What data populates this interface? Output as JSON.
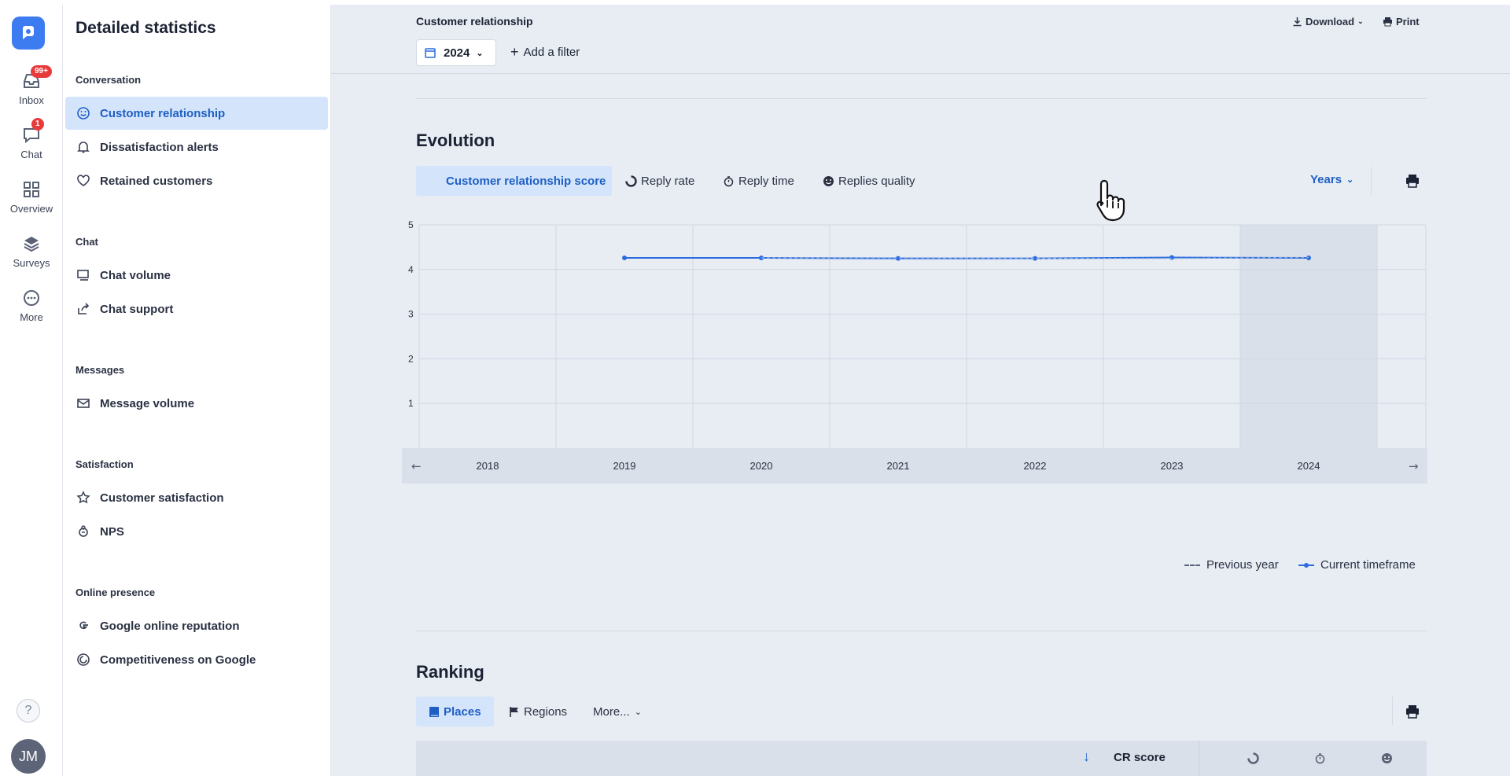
{
  "rail": {
    "items": [
      {
        "label": "Inbox",
        "badge": "99+"
      },
      {
        "label": "Chat",
        "badge": "1"
      },
      {
        "label": "Overview"
      },
      {
        "label": "Surveys"
      },
      {
        "label": "More"
      }
    ],
    "help": "?",
    "avatar": "JM"
  },
  "sidebar": {
    "title": "Detailed statistics",
    "sections": [
      {
        "title": "Conversation",
        "items": [
          "Customer relationship",
          "Dissatisfaction alerts",
          "Retained customers"
        ]
      },
      {
        "title": "Chat",
        "items": [
          "Chat volume",
          "Chat support"
        ]
      },
      {
        "title": "Messages",
        "items": [
          "Message volume"
        ]
      },
      {
        "title": "Satisfaction",
        "items": [
          "Customer satisfaction",
          "NPS"
        ]
      },
      {
        "title": "Online presence",
        "items": [
          "Google online reputation",
          "Competitiveness on Google"
        ]
      }
    ],
    "active_item": "Customer relationship"
  },
  "header": {
    "title": "Customer relationship",
    "year": "2024",
    "add_filter": "Add a filter",
    "download": "Download",
    "print": "Print"
  },
  "evolution": {
    "title": "Evolution",
    "tabs": [
      "Customer relationship score",
      "Reply rate",
      "Reply time",
      "Replies quality"
    ],
    "period": "Years",
    "legend": {
      "previous": "Previous year",
      "current": "Current timeframe"
    }
  },
  "chart_data": {
    "type": "line",
    "x": [
      "2018",
      "2019",
      "2020",
      "2021",
      "2022",
      "2023",
      "2024"
    ],
    "ylim": [
      0,
      5
    ],
    "yticks": [
      1,
      2,
      3,
      4,
      5
    ],
    "highlight": "2024",
    "series": [
      {
        "name": "Current timeframe",
        "values": [
          null,
          4.26,
          4.26,
          4.25,
          4.25,
          4.27,
          4.26
        ]
      },
      {
        "name": "Previous year",
        "values": [
          null,
          null,
          4.26,
          4.26,
          4.25,
          4.25,
          4.27
        ]
      }
    ],
    "colors": {
      "current": "#2a6ce0",
      "previous": "#8aa8d8"
    }
  },
  "ranking": {
    "title": "Ranking",
    "tabs": [
      "Places",
      "Regions",
      "More..."
    ],
    "columns": [
      "CR score"
    ]
  }
}
